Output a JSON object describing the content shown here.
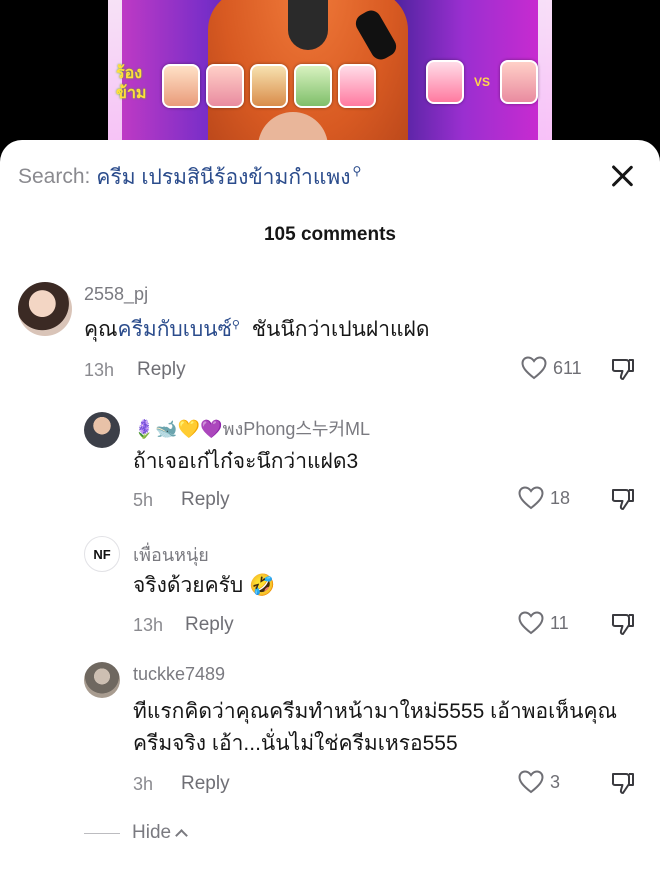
{
  "search": {
    "prefix": "Search:",
    "query": "ครีม เปรมสินีร้องข้ามกำแพง"
  },
  "comments_header": "105 comments",
  "comments": [
    {
      "username": "2558_pj",
      "text_parts": [
        "คุณ",
        "ครีมกับเบนซ์",
        " ชันนึกว่าเปนฝาแฝด"
      ],
      "time": "13h",
      "reply_label": "Reply",
      "likes": "611"
    }
  ],
  "replies": [
    {
      "username_emoji": "🪻🐋💛💜",
      "username": "พงPhong스누커ML",
      "text": "ถ้าเจอเก๋ไก๋จะนึกว่าแฝด3",
      "time": "5h",
      "reply_label": "Reply",
      "likes": "18"
    },
    {
      "username": "เพื่อนหนุ่ย",
      "text": "จริงด้วยครับ 🤣",
      "time": "13h",
      "reply_label": "Reply",
      "likes": "11"
    },
    {
      "username": "tuckke7489",
      "text_line1": "ทีแรกคิดว่าคุณครีมทำหน้ามาใหม่5555 เอ้าพอเห็นคุณ",
      "text_line2": "ครีมจริง เอ้า...นั่นไม่ใช่ครีมเหรอ555",
      "time": "3h",
      "reply_label": "Reply",
      "likes": "3"
    }
  ],
  "hide_label": "Hide",
  "video": {
    "logo_text": "ร้อง\nข้าม",
    "vs_text": "VS"
  },
  "colors": {
    "link": "#2b4c8c",
    "muted": "#8a8a8f",
    "text": "#161616"
  },
  "icons": [
    "close-icon",
    "heart-icon",
    "dislike-icon",
    "search-suggest-icon",
    "chevron-up-icon"
  ]
}
